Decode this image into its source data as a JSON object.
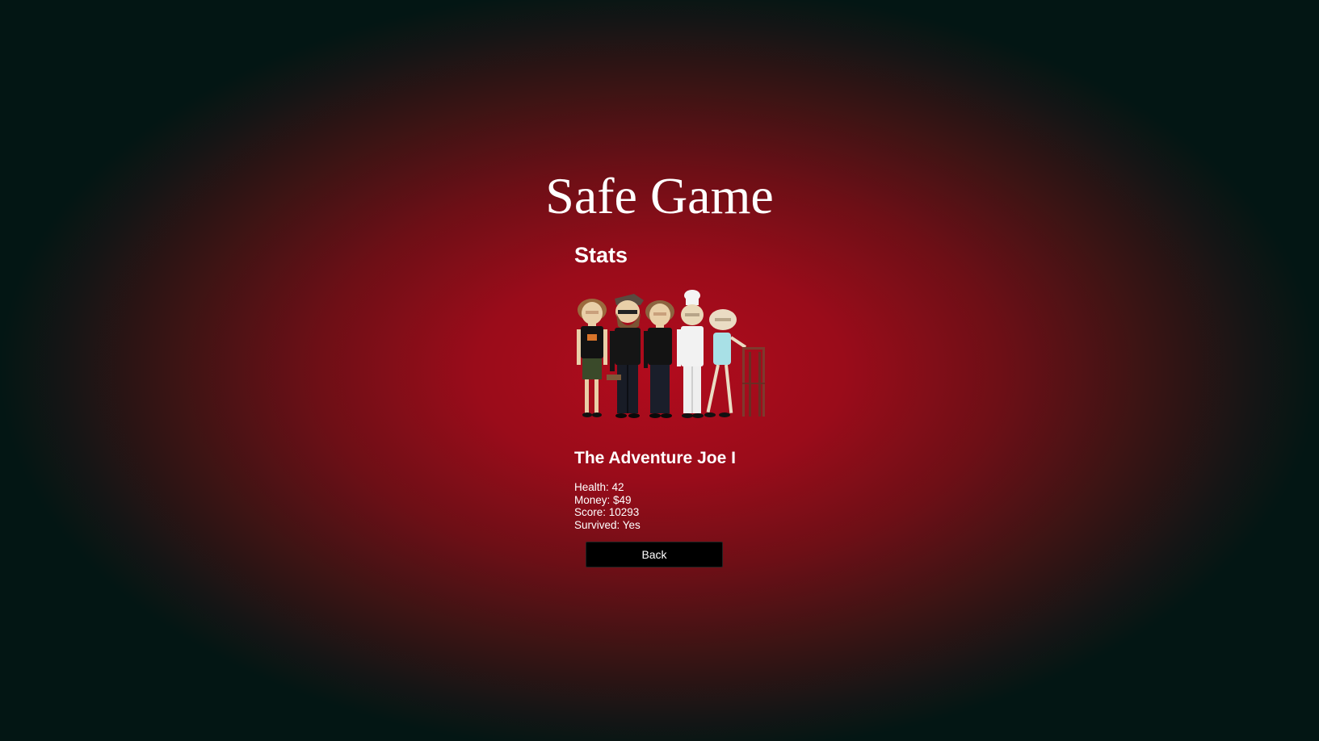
{
  "page": {
    "title": "Safe Game"
  },
  "stats": {
    "heading": "Stats",
    "image_icon": "character-lineup-image",
    "character_name": "The Adventure Joe I",
    "items": [
      {
        "label": "Health",
        "value": "42",
        "text": "Health: 42"
      },
      {
        "label": "Money",
        "value": "$49",
        "text": "Money: $49"
      },
      {
        "label": "Score",
        "value": "10293",
        "text": "Score: 10293"
      },
      {
        "label": "Survived",
        "value": "Yes",
        "text": "Survived: Yes"
      }
    ],
    "back_label": "Back"
  },
  "colors": {
    "background_center": "#b20b1d",
    "background_edge": "#031614",
    "text": "#ffffff",
    "button_bg": "#000000"
  }
}
